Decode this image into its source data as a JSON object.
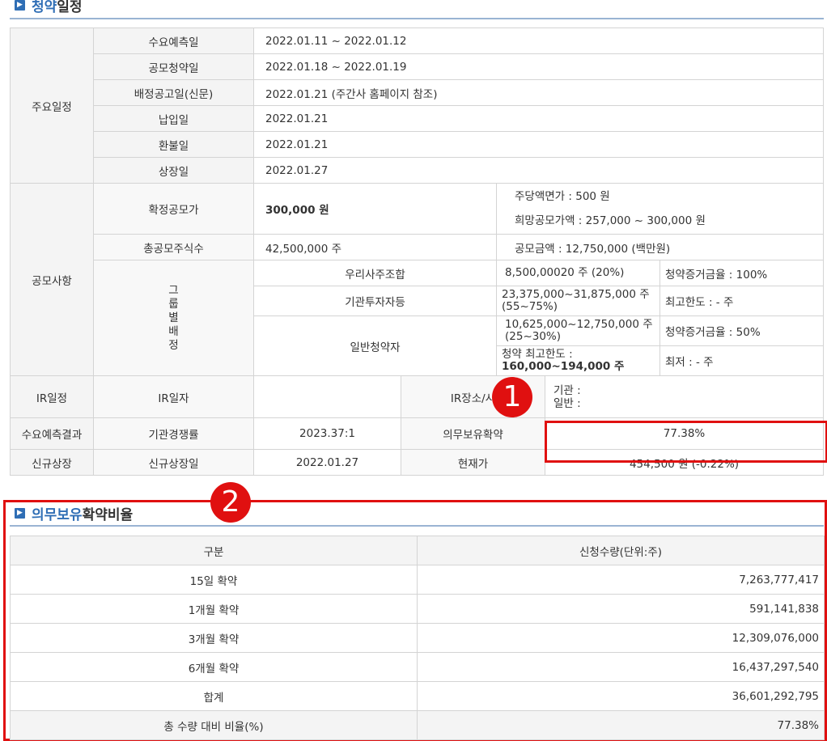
{
  "section1": {
    "title_prefix": "청약",
    "title_suffix": " 일정",
    "icon": "blue-square-icon"
  },
  "schedule": {
    "group_label": "주요일정",
    "rows": [
      {
        "label": "수요예측일",
        "value": "2022.01.11   ~   2022.01.12"
      },
      {
        "label": "공모청약일",
        "value": "2022.01.18   ~   2022.01.19"
      },
      {
        "label": "배정공고일(신문)",
        "value": "2022.01.21 (주간사 홈페이지 참조)"
      },
      {
        "label": "납입일",
        "value": "2022.01.21"
      },
      {
        "label": "환불일",
        "value": "2022.01.21"
      },
      {
        "label": "상장일",
        "value": "2022.01.27"
      }
    ]
  },
  "offering": {
    "group_label": "공모사항",
    "confirmed_price_label": "확정공모가",
    "confirmed_price_value": "300,000 원",
    "par_value": "주당액면가 :  500 원",
    "desired_price": "희망공모가액 :  257,000 ~ 300,000 원",
    "total_shares_label": "총공모주식수",
    "total_shares_value": "42,500,000 주",
    "offering_amount": "공모금액 : 12,750,000 (백만원)",
    "allocation_label": "그룹별배정",
    "alloc": [
      {
        "group": "우리사주조합",
        "shares": "8,500,00020 주  (20%)",
        "note": "청약증거금율 : 100%"
      },
      {
        "group": "기관투자자등",
        "shares": "23,375,000~31,875,000 주 (55~75%)",
        "note": "최고한도 :  - 주"
      },
      {
        "group": "일반청약자",
        "shares": "10,625,000~12,750,000 주 (25~30%)",
        "note": "청약증거금율 : 50%",
        "limit": "청약 최고한도 :",
        "limit_value": "160,000~194,000 주",
        "min_note": "최저 :  - 주"
      }
    ]
  },
  "ir": {
    "label": "IR일정",
    "date_label": "IR일자",
    "date_value": "",
    "place_label": "IR장소/시",
    "place_institution": "기관 :",
    "place_general": "일반 :"
  },
  "demand": {
    "label": "수요예측결과",
    "competition_label": "기관경쟁률",
    "competition_value": "2023.37:1",
    "lockup_label": "의무보유확약",
    "lockup_value": "77.38%"
  },
  "listing": {
    "label": "신규상장",
    "date_label": "신규상장일",
    "date_value": "2022.01.27",
    "price_label": "현재가",
    "price_value": "454,500 원 (-0.22%)"
  },
  "section2": {
    "title_prefix": "의무보유",
    "title_suffix": " 확약비율",
    "icon": "blue-square-icon"
  },
  "lockup_table": {
    "headers": [
      "구분",
      "신청수량(단위:주)"
    ],
    "rows": [
      {
        "label": "15일 확약",
        "value": "7,263,777,417"
      },
      {
        "label": "1개월 확약",
        "value": "591,141,838"
      },
      {
        "label": "3개월 확약",
        "value": "12,309,076,000"
      },
      {
        "label": "6개월 확약",
        "value": "16,437,297,540"
      },
      {
        "label": "합계",
        "value": "36,601,292,795"
      },
      {
        "label": "총 수량 대비 비율(%)",
        "value": "77.38%"
      }
    ]
  },
  "markers": [
    "1",
    "2"
  ],
  "accent_color": "#e01010",
  "brand_color": "#2f6eb5"
}
